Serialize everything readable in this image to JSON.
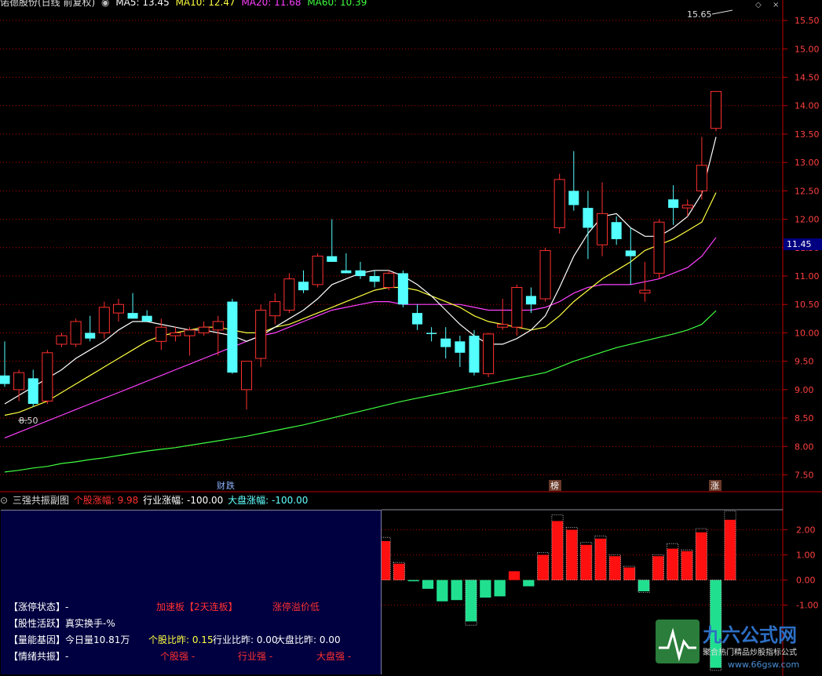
{
  "header": {
    "stock": "诺德股份(日线 前复权)",
    "ma5": "MA5: 13.45",
    "ma10": "MA10: 12.47",
    "ma20": "MA20: 11.68",
    "ma60": "MA60: 10.39"
  },
  "markers": {
    "high_label": "15.65",
    "low_label": "8.50",
    "current_price": "11.45",
    "event_1": "财",
    "event_2": "跌",
    "event_3": "榜",
    "event_4": "涨"
  },
  "sub_header": {
    "title": "三强共振副图",
    "stock_change": "个股涨幅: 9.98",
    "industry_change": "行业涨幅: -100.00",
    "market_change": "大盘涨幅: -100.00"
  },
  "panel": {
    "limit_state": "【涨停状态】-",
    "limit_value": "加速板【2天连板】",
    "limit_value2": "涨停溢价低",
    "activity": "【股性活跃】真实换手-%",
    "volume": "【量能基因】今日量10.81万",
    "ratio_stock": "个股比昨: 0.15",
    "ratio_industry": "行业比昨: 0.00",
    "ratio_market": "大盘比昨: 0.00",
    "resonance": "【情绪共振】-",
    "strong_stock": "个股强 -",
    "strong_industry": "行业强 -",
    "strong_market": "大盘强 -"
  },
  "watermark": {
    "brand": "九六公式网",
    "slogan": "聚合热门精品炒股指标公式",
    "url": "www.66gsw.com"
  },
  "colors": {
    "up": "#ff3030",
    "down": "#54ffff",
    "ma5": "#ffffff",
    "ma10": "#ffff40",
    "ma20": "#ff40ff",
    "ma60": "#40ff40",
    "grid": "#b00000"
  },
  "chart_data": [
    {
      "type": "candlestick",
      "title": "诺德股份(日线 前复权)",
      "y_ticks": [
        7.5,
        8.0,
        8.5,
        9.0,
        9.5,
        10.0,
        10.5,
        11.0,
        11.5,
        12.0,
        12.5,
        13.0,
        13.5,
        14.0,
        14.5,
        15.0,
        15.5
      ],
      "ylim": [
        7.3,
        15.75
      ],
      "candles": [
        {
          "o": 9.25,
          "h": 9.85,
          "l": 9.05,
          "c": 9.1
        },
        {
          "o": 9.0,
          "h": 9.35,
          "l": 8.8,
          "c": 9.3
        },
        {
          "o": 9.2,
          "h": 9.35,
          "l": 8.7,
          "c": 8.75
        },
        {
          "o": 8.8,
          "h": 9.7,
          "l": 8.75,
          "c": 9.65
        },
        {
          "o": 9.8,
          "h": 10.0,
          "l": 9.75,
          "c": 9.95
        },
        {
          "o": 9.8,
          "h": 10.25,
          "l": 9.75,
          "c": 10.2
        },
        {
          "o": 10.0,
          "h": 10.3,
          "l": 9.85,
          "c": 9.9
        },
        {
          "o": 10.0,
          "h": 10.55,
          "l": 9.9,
          "c": 10.45
        },
        {
          "o": 10.35,
          "h": 10.6,
          "l": 10.2,
          "c": 10.5
        },
        {
          "o": 10.35,
          "h": 10.7,
          "l": 10.3,
          "c": 10.25
        },
        {
          "o": 10.3,
          "h": 10.4,
          "l": 10.25,
          "c": 10.2
        },
        {
          "o": 9.85,
          "h": 10.25,
          "l": 9.7,
          "c": 10.1
        },
        {
          "o": 9.95,
          "h": 10.1,
          "l": 9.85,
          "c": 10.0
        },
        {
          "o": 9.95,
          "h": 10.1,
          "l": 9.6,
          "c": 10.05
        },
        {
          "o": 10.0,
          "h": 10.2,
          "l": 9.95,
          "c": 10.1
        },
        {
          "o": 10.05,
          "h": 10.3,
          "l": 9.6,
          "c": 10.2
        },
        {
          "o": 10.55,
          "h": 10.6,
          "l": 9.28,
          "c": 9.3
        },
        {
          "o": 9.0,
          "h": 9.4,
          "l": 8.65,
          "c": 9.5
        },
        {
          "o": 9.55,
          "h": 10.5,
          "l": 9.4,
          "c": 10.4
        },
        {
          "o": 10.3,
          "h": 10.7,
          "l": 10.15,
          "c": 10.55
        },
        {
          "o": 10.4,
          "h": 11.05,
          "l": 10.35,
          "c": 10.95
        },
        {
          "o": 10.9,
          "h": 11.1,
          "l": 10.7,
          "c": 10.75
        },
        {
          "o": 10.85,
          "h": 11.4,
          "l": 10.8,
          "c": 11.35
        },
        {
          "o": 11.35,
          "h": 12.0,
          "l": 11.25,
          "c": 11.25
        },
        {
          "o": 11.1,
          "h": 11.4,
          "l": 11.05,
          "c": 11.05
        },
        {
          "o": 11.1,
          "h": 11.25,
          "l": 10.95,
          "c": 11.0
        },
        {
          "o": 11.0,
          "h": 11.1,
          "l": 10.8,
          "c": 10.9
        },
        {
          "o": 10.8,
          "h": 11.1,
          "l": 10.75,
          "c": 11.05
        },
        {
          "o": 11.05,
          "h": 11.1,
          "l": 10.45,
          "c": 10.5
        },
        {
          "o": 10.35,
          "h": 10.5,
          "l": 10.05,
          "c": 10.15
        },
        {
          "o": 10.0,
          "h": 10.1,
          "l": 9.85,
          "c": 9.98
        },
        {
          "o": 9.9,
          "h": 10.1,
          "l": 9.55,
          "c": 9.75
        },
        {
          "o": 9.85,
          "h": 9.95,
          "l": 9.4,
          "c": 9.65
        },
        {
          "o": 9.95,
          "h": 10.05,
          "l": 9.25,
          "c": 9.3
        },
        {
          "o": 9.28,
          "h": 10.0,
          "l": 9.22,
          "c": 9.98
        },
        {
          "o": 10.1,
          "h": 10.6,
          "l": 10.05,
          "c": 10.15
        },
        {
          "o": 10.1,
          "h": 10.85,
          "l": 9.95,
          "c": 10.8
        },
        {
          "o": 10.65,
          "h": 10.8,
          "l": 10.35,
          "c": 10.5
        },
        {
          "o": 10.6,
          "h": 11.5,
          "l": 10.55,
          "c": 11.45
        },
        {
          "o": 11.85,
          "h": 12.8,
          "l": 11.75,
          "c": 12.7
        },
        {
          "o": 12.5,
          "h": 13.2,
          "l": 12.15,
          "c": 12.25
        },
        {
          "o": 12.2,
          "h": 12.5,
          "l": 11.3,
          "c": 11.85
        },
        {
          "o": 11.55,
          "h": 12.65,
          "l": 11.35,
          "c": 12.1
        },
        {
          "o": 11.95,
          "h": 12.05,
          "l": 11.55,
          "c": 11.65
        },
        {
          "o": 11.45,
          "h": 11.85,
          "l": 10.85,
          "c": 11.35
        },
        {
          "o": 10.7,
          "h": 11.25,
          "l": 10.55,
          "c": 10.75
        },
        {
          "o": 11.05,
          "h": 12.0,
          "l": 10.95,
          "c": 11.95
        },
        {
          "o": 12.35,
          "h": 12.6,
          "l": 11.9,
          "c": 12.2
        },
        {
          "o": 12.2,
          "h": 12.35,
          "l": 12.05,
          "c": 12.25
        },
        {
          "o": 12.5,
          "h": 13.45,
          "l": 12.35,
          "c": 12.95
        },
        {
          "o": 13.6,
          "h": 14.25,
          "l": 13.55,
          "c": 14.25
        }
      ],
      "ma5": [
        8.75,
        8.9,
        9.05,
        9.2,
        9.35,
        9.55,
        9.7,
        9.85,
        10.05,
        10.2,
        10.2,
        10.15,
        10.1,
        10.05,
        10.05,
        10.0,
        9.95,
        9.85,
        9.95,
        10.1,
        10.25,
        10.4,
        10.6,
        10.85,
        10.95,
        11.05,
        11.1,
        11.1,
        11.0,
        10.85,
        10.65,
        10.4,
        10.15,
        9.95,
        9.8,
        9.8,
        9.9,
        10.05,
        10.3,
        10.8,
        11.35,
        11.75,
        12.05,
        12.1,
        11.85,
        11.7,
        11.7,
        11.85,
        12.05,
        12.45,
        13.45
      ],
      "ma10": [
        8.55,
        8.6,
        8.7,
        8.8,
        8.95,
        9.1,
        9.25,
        9.4,
        9.55,
        9.7,
        9.85,
        9.95,
        10.0,
        10.05,
        10.1,
        10.1,
        10.05,
        10.0,
        10.0,
        10.1,
        10.15,
        10.25,
        10.35,
        10.45,
        10.55,
        10.65,
        10.75,
        10.8,
        10.8,
        10.75,
        10.65,
        10.55,
        10.45,
        10.3,
        10.2,
        10.15,
        10.1,
        10.05,
        10.1,
        10.3,
        10.55,
        10.75,
        10.95,
        11.1,
        11.25,
        11.45,
        11.55,
        11.65,
        11.8,
        11.95,
        12.47
      ],
      "ma20": [
        8.15,
        8.25,
        8.35,
        8.45,
        8.55,
        8.65,
        8.75,
        8.85,
        8.95,
        9.05,
        9.15,
        9.25,
        9.35,
        9.45,
        9.55,
        9.65,
        9.75,
        9.85,
        9.95,
        10.0,
        10.1,
        10.2,
        10.3,
        10.4,
        10.45,
        10.5,
        10.55,
        10.55,
        10.5,
        10.5,
        10.5,
        10.5,
        10.5,
        10.45,
        10.4,
        10.4,
        10.4,
        10.4,
        10.45,
        10.55,
        10.7,
        10.8,
        10.85,
        10.85,
        10.85,
        10.9,
        10.95,
        11.05,
        11.15,
        11.35,
        11.68
      ],
      "ma60": [
        7.55,
        7.58,
        7.62,
        7.65,
        7.7,
        7.73,
        7.77,
        7.8,
        7.84,
        7.88,
        7.92,
        7.95,
        7.98,
        8.02,
        8.06,
        8.1,
        8.14,
        8.18,
        8.23,
        8.28,
        8.33,
        8.38,
        8.44,
        8.5,
        8.56,
        8.62,
        8.68,
        8.74,
        8.8,
        8.85,
        8.9,
        8.95,
        9.0,
        9.05,
        9.1,
        9.15,
        9.2,
        9.25,
        9.3,
        9.4,
        9.5,
        9.58,
        9.66,
        9.74,
        9.8,
        9.86,
        9.92,
        9.98,
        10.05,
        10.15,
        10.39
      ]
    },
    {
      "type": "bar",
      "title": "三强共振副图",
      "y_ticks": [
        -1.0,
        0.0,
        1.0,
        2.0
      ],
      "ylim": [
        -3.7,
        2.8
      ],
      "values": [
        1.55,
        0.65,
        -0.05,
        -0.35,
        -0.85,
        -0.8,
        -1.65,
        -0.7,
        -0.65,
        0.35,
        -0.25,
        1.0,
        2.35,
        2.0,
        1.4,
        1.65,
        0.95,
        0.5,
        -0.45,
        0.95,
        1.25,
        1.15,
        1.9,
        -3.5,
        2.4
      ],
      "caps": [
        1.7,
        0.7,
        0.0,
        0.0,
        0.0,
        0.0,
        -1.8,
        0.0,
        0.0,
        0.0,
        0.0,
        1.1,
        2.6,
        2.1,
        1.5,
        1.75,
        1.0,
        0.55,
        -0.5,
        1.0,
        1.45,
        1.2,
        2.05,
        -3.6,
        2.75
      ]
    }
  ]
}
